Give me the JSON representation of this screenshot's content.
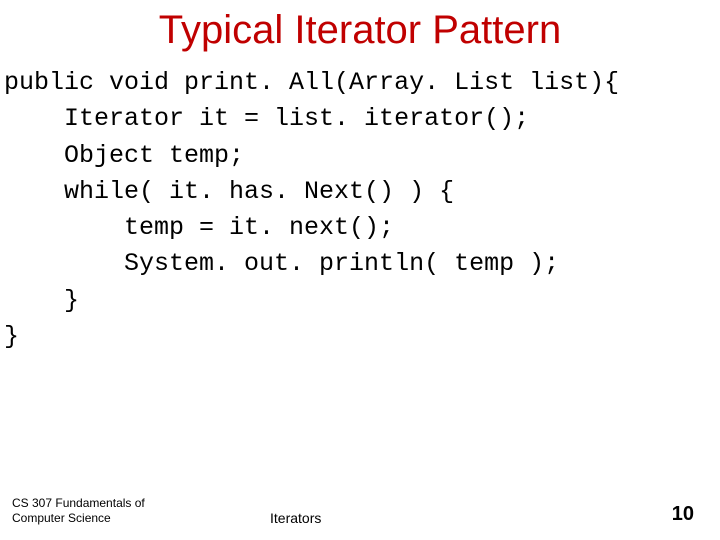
{
  "title": "Typical Iterator Pattern",
  "code": {
    "l1": "public void print. All(Array. List list){",
    "l2": "    Iterator it = list. iterator();",
    "l3": "    Object temp;",
    "l4": "    while( it. has. Next() ) {",
    "l5": "        temp = it. next();",
    "l6": "        System. out. println( temp );",
    "l7": "    }",
    "l8": "}"
  },
  "footer": {
    "course_line1": "CS 307 Fundamentals of",
    "course_line2": "Computer Science",
    "topic": "Iterators",
    "page": "10"
  }
}
